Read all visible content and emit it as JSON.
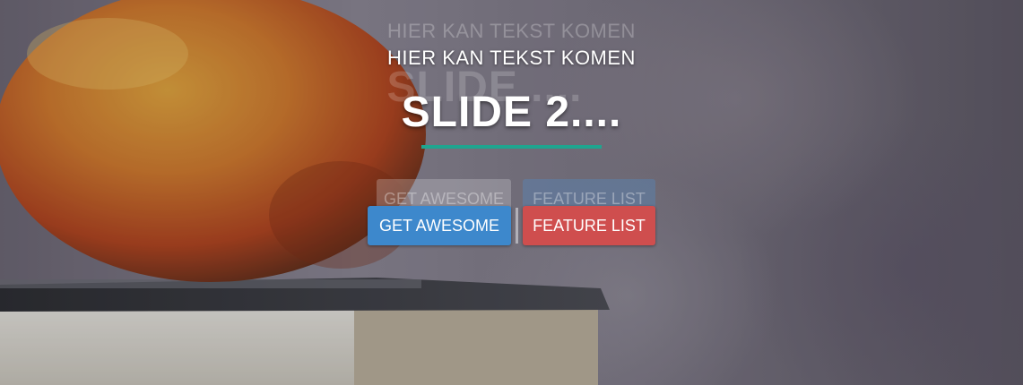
{
  "slide": {
    "ghost_subtitle": "HIER KAN TEKST KOMEN",
    "subtitle": "HIER KAN TEKST KOMEN",
    "ghost_title": "SLIDE ....",
    "title": "SLIDE 2....",
    "accent_color": "#1fa58f"
  },
  "buttons": {
    "ghost_primary": "GET AWESOME",
    "ghost_secondary": "FEATURE LIST",
    "primary": "GET AWESOME",
    "secondary": "FEATURE LIST",
    "primary_color": "#3d88cc",
    "secondary_color": "#cf4e4e"
  }
}
